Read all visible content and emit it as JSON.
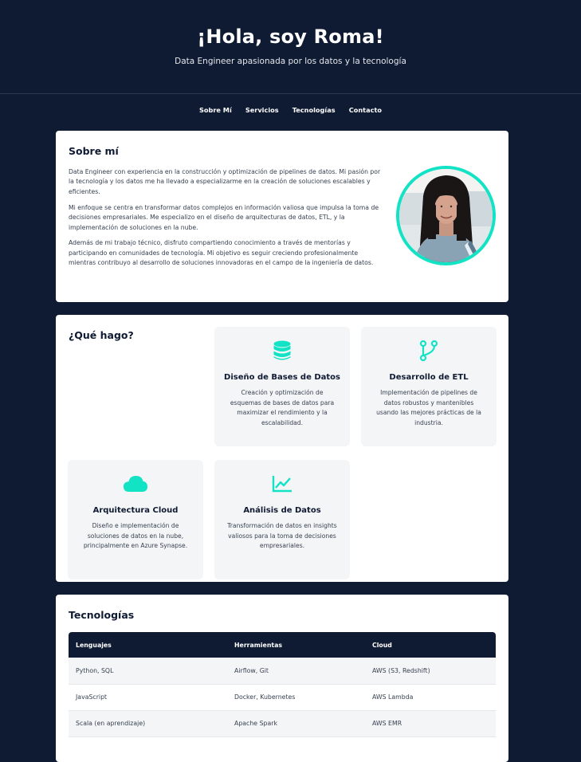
{
  "hero": {
    "title": "¡Hola, soy Roma!",
    "subtitle": "Data Engineer apasionada por los datos y la tecnología"
  },
  "nav": {
    "items": [
      "Sobre Mí",
      "Servicios",
      "Tecnologías",
      "Contacto"
    ]
  },
  "about": {
    "heading": "Sobre mí",
    "paragraphs": [
      "Data Engineer con experiencia en la construcción y optimización de pipelines de datos. Mi pasión por la tecnología y los datos me ha llevado a especializarme en la creación de soluciones escalables y eficientes.",
      "Mi enfoque se centra en transformar datos complejos en información valiosa que impulsa la toma de decisiones empresariales. Me especializo en el diseño de arquitecturas de datos, ETL, y la implementación de soluciones en la nube.",
      "Además de mi trabajo técnico, disfruto compartiendo conocimiento a través de mentorías y participando en comunidades de tecnología. Mi objetivo es seguir creciendo profesionalmente mientras contribuyo al desarrollo de soluciones innovadoras en el campo de la ingeniería de datos."
    ]
  },
  "services": {
    "heading": "¿Qué hago?",
    "accent_color": "#12e3c5",
    "items": [
      {
        "icon": "database-icon",
        "title": "Diseño de Bases de Datos",
        "description": "Creación y optimización de esquemas de bases de datos para maximizar el rendimiento y la escalabilidad."
      },
      {
        "icon": "code-branch-icon",
        "title": "Desarrollo de ETL",
        "description": "Implementación de pipelines de datos robustos y mantenibles usando las mejores prácticas de la industria."
      },
      {
        "icon": "cloud-icon",
        "title": "Arquitectura Cloud",
        "description": "Diseño e implementación de soluciones de datos en la nube, principalmente en Azure Synapse."
      },
      {
        "icon": "chart-line-icon",
        "title": "Análisis de Datos",
        "description": "Transformación de datos en insights valiosos para la toma de decisiones empresariales."
      }
    ]
  },
  "tech": {
    "heading": "Tecnologías",
    "columns": [
      "Lenguajes",
      "Herramientas",
      "Cloud"
    ],
    "rows": [
      [
        "Python, SQL",
        "Airflow, Git",
        "AWS (S3, Redshift)"
      ],
      [
        "JavaScript",
        "Docker, Kubernetes",
        "AWS Lambda"
      ],
      [
        "Scala (en aprendizaje)",
        "Apache Spark",
        "AWS EMR"
      ]
    ]
  },
  "colors": {
    "background": "#0f1a33",
    "accent": "#12e3c5",
    "card": "#ffffff"
  }
}
